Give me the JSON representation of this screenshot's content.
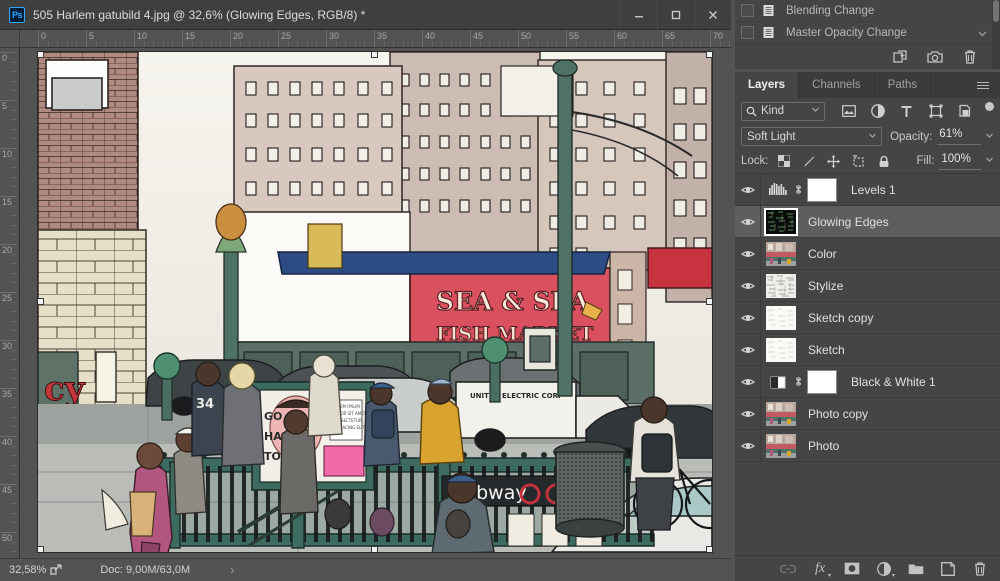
{
  "window": {
    "app_icon": "photoshop-logo-icon",
    "title": "505 Harlem gatubild 4.jpg @ 32,6% (Glowing Edges, RGB/8) *",
    "controls": [
      {
        "name": "minimize-button",
        "glyph": "minimize-icon"
      },
      {
        "name": "maximize-button",
        "glyph": "maximize-icon"
      },
      {
        "name": "close-button",
        "glyph": "close-icon"
      }
    ]
  },
  "rulers": {
    "unit_step": 5,
    "horizontal_labels": [
      "0",
      "5",
      "10",
      "15",
      "20",
      "25",
      "30",
      "35",
      "40",
      "45",
      "50",
      "55",
      "60",
      "65",
      "70"
    ],
    "vertical_labels": [
      "0",
      "5",
      "10",
      "15",
      "20",
      "25",
      "30",
      "35",
      "40",
      "45",
      "50"
    ]
  },
  "canvas": {
    "image_description": "Harlem street scene with Glowing Edges filter, Sea & Sea Fish Market sign, subway entrance, pedestrians and cars",
    "signs": {
      "fish_market_line1": "SEA & SEA",
      "fish_market_line2": "FISH MARKET",
      "subway": "Subway",
      "corner_store": "CY"
    }
  },
  "status_bar": {
    "zoom": "32,58%",
    "share_icon": "share-icon",
    "doc_info": "Doc: 9,00M/63,0M",
    "expand_arrow": "›"
  },
  "history_panel": {
    "items": [
      {
        "label": "Blending Change",
        "icon": "history-state-icon"
      },
      {
        "label": "Master Opacity Change",
        "icon": "history-state-icon"
      }
    ],
    "tools": [
      {
        "name": "new-document-from-state-button",
        "icon": "new-doc-icon"
      },
      {
        "name": "new-snapshot-button",
        "icon": "camera-icon"
      },
      {
        "name": "delete-state-button",
        "icon": "trash-icon"
      }
    ]
  },
  "layers_panel": {
    "tabs": [
      {
        "label": "Layers",
        "active": true
      },
      {
        "label": "Channels",
        "active": false
      },
      {
        "label": "Paths",
        "active": false
      }
    ],
    "menu_icon": "panel-menu-icon",
    "filter": {
      "kind_label": "Kind",
      "search_icon": "search-icon",
      "chevron": "chevron-down-icon",
      "type_filters": [
        {
          "name": "filter-pixel-layers",
          "icon": "image-icon"
        },
        {
          "name": "filter-adjustment-layers",
          "icon": "half-circle-icon"
        },
        {
          "name": "filter-type-layers",
          "icon": "text-t-icon"
        },
        {
          "name": "filter-shape-layers",
          "icon": "shape-icon"
        },
        {
          "name": "filter-smart-objects",
          "icon": "smart-object-icon"
        }
      ],
      "toggle_name": "filter-enable-toggle"
    },
    "blend_mode": "Soft Light",
    "opacity_label": "Opacity:",
    "opacity_value": "61%",
    "lock_label": "Lock:",
    "lock_icons": [
      {
        "name": "lock-transparent-pixels",
        "icon": "checkerboard-icon"
      },
      {
        "name": "lock-image-pixels",
        "icon": "brush-icon"
      },
      {
        "name": "lock-position",
        "icon": "move-arrows-icon"
      },
      {
        "name": "lock-artboard-nesting",
        "icon": "artboard-icon"
      },
      {
        "name": "lock-all",
        "icon": "padlock-icon"
      }
    ],
    "fill_label": "Fill:",
    "fill_value": "100%",
    "layers": [
      {
        "name": "Levels 1",
        "type": "adjustment",
        "adj_icon": "levels-icon",
        "has_mask": true,
        "linked": true,
        "visible": true,
        "selected": false,
        "thumb": "none"
      },
      {
        "name": "Glowing Edges",
        "type": "pixel",
        "adj_icon": "",
        "has_mask": false,
        "linked": false,
        "visible": true,
        "selected": true,
        "thumb": "dark-edges"
      },
      {
        "name": "Color",
        "type": "pixel",
        "adj_icon": "",
        "has_mask": false,
        "linked": false,
        "visible": true,
        "selected": false,
        "thumb": "photo"
      },
      {
        "name": "Stylize",
        "type": "pixel",
        "adj_icon": "",
        "has_mask": false,
        "linked": false,
        "visible": true,
        "selected": false,
        "thumb": "sketch-grey"
      },
      {
        "name": "Sketch copy",
        "type": "pixel",
        "adj_icon": "",
        "has_mask": false,
        "linked": false,
        "visible": true,
        "selected": false,
        "thumb": "sketch-light"
      },
      {
        "name": "Sketch",
        "type": "pixel",
        "adj_icon": "",
        "has_mask": false,
        "linked": false,
        "visible": true,
        "selected": false,
        "thumb": "sketch-light"
      },
      {
        "name": "Black & White 1",
        "type": "adjustment",
        "adj_icon": "black-white-icon",
        "has_mask": true,
        "linked": true,
        "visible": true,
        "selected": false,
        "thumb": "none"
      },
      {
        "name": "Photo copy",
        "type": "pixel",
        "adj_icon": "",
        "has_mask": false,
        "linked": false,
        "visible": true,
        "selected": false,
        "thumb": "photo"
      },
      {
        "name": "Photo",
        "type": "pixel",
        "adj_icon": "",
        "has_mask": false,
        "linked": false,
        "visible": true,
        "selected": false,
        "thumb": "photo"
      }
    ],
    "footer_buttons": [
      {
        "name": "link-layers-button",
        "icon": "link-icon",
        "enabled": false
      },
      {
        "name": "layer-style-button",
        "icon": "fx-icon",
        "enabled": true
      },
      {
        "name": "add-layer-mask-button",
        "icon": "mask-icon",
        "enabled": true
      },
      {
        "name": "new-adjustment-layer-button",
        "icon": "half-circle-icon",
        "enabled": true
      },
      {
        "name": "new-group-button",
        "icon": "folder-icon",
        "enabled": true
      },
      {
        "name": "new-layer-button",
        "icon": "new-layer-icon",
        "enabled": true
      },
      {
        "name": "delete-layer-button",
        "icon": "trash-icon",
        "enabled": true
      }
    ]
  },
  "colors": {
    "panel_bg": "#454545",
    "window_bg": "#535353",
    "titlebar_bg": "#3f3f3f",
    "selected_row": "#5e5e5e",
    "accent_blue": "#31a8ff",
    "text": "#d8d8d8"
  }
}
